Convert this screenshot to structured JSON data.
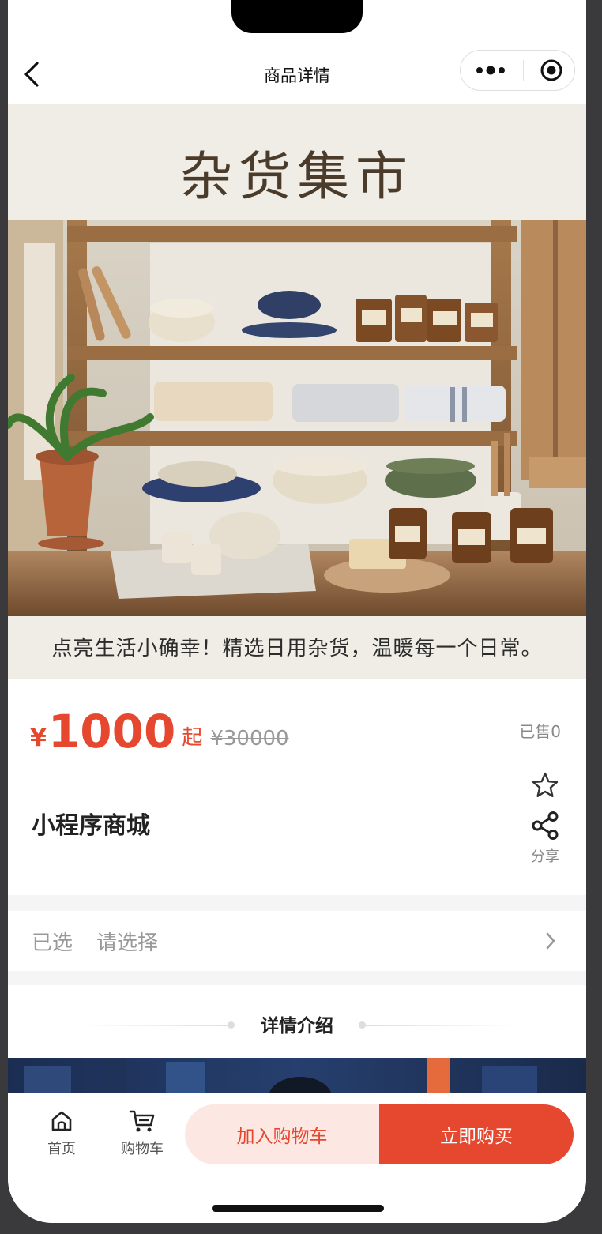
{
  "navbar": {
    "title": "商品详情"
  },
  "banner": {
    "title": "杂货集市",
    "caption": "点亮生活小确幸！精选日用杂货，温暖每一个日常。"
  },
  "product": {
    "currency": "¥",
    "price": "1000",
    "price_suffix": "起",
    "original_price": "¥30000",
    "sold": "已售0",
    "name": "小程序商城",
    "share_label": "分享"
  },
  "spec": {
    "label": "已选",
    "value": "请选择"
  },
  "detail": {
    "title": "详情介绍"
  },
  "tabbar": {
    "home_label": "首页",
    "cart_label": "购物车",
    "add_cart_label": "加入购物车",
    "buy_label": "立即购买"
  },
  "colors": {
    "accent": "#e5472f",
    "accent_light": "#fce7e3"
  }
}
